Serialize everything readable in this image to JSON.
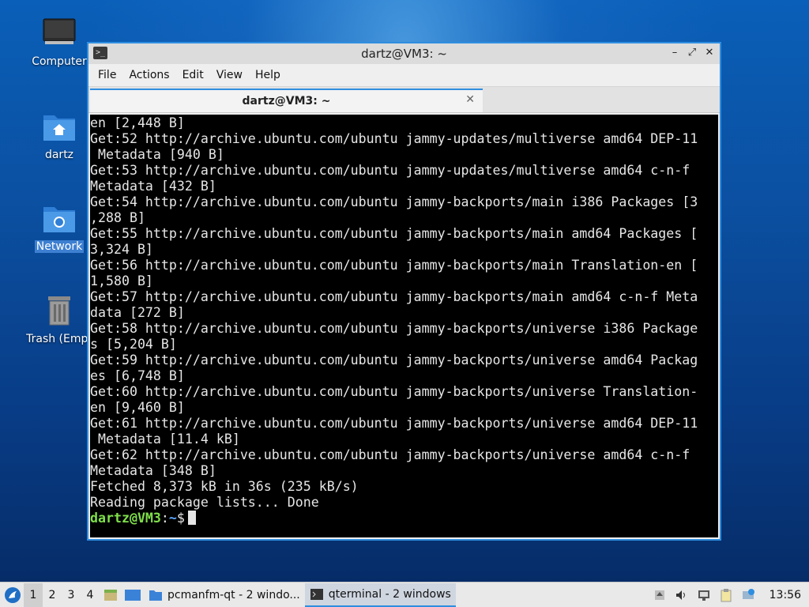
{
  "desktop": {
    "icons": [
      {
        "label": "Computer",
        "icon": "computer-icon"
      },
      {
        "label": "dartz",
        "icon": "home-folder-icon"
      },
      {
        "label": "Network",
        "icon": "network-folder-icon"
      },
      {
        "label": "Trash (Empt",
        "icon": "trash-icon"
      }
    ]
  },
  "window": {
    "title": "dartz@VM3: ~",
    "menu": [
      "File",
      "Actions",
      "Edit",
      "View",
      "Help"
    ],
    "tab_label": "dartz@VM3: ~",
    "tab_close": "✕",
    "terminal_lines": [
      "en [2,448 B]",
      "Get:52 http://archive.ubuntu.com/ubuntu jammy-updates/multiverse amd64 DEP-11",
      " Metadata [940 B]",
      "Get:53 http://archive.ubuntu.com/ubuntu jammy-updates/multiverse amd64 c-n-f",
      "Metadata [432 B]",
      "Get:54 http://archive.ubuntu.com/ubuntu jammy-backports/main i386 Packages [3",
      ",288 B]",
      "Get:55 http://archive.ubuntu.com/ubuntu jammy-backports/main amd64 Packages [",
      "3,324 B]",
      "Get:56 http://archive.ubuntu.com/ubuntu jammy-backports/main Translation-en [",
      "1,580 B]",
      "Get:57 http://archive.ubuntu.com/ubuntu jammy-backports/main amd64 c-n-f Meta",
      "data [272 B]",
      "Get:58 http://archive.ubuntu.com/ubuntu jammy-backports/universe i386 Package",
      "s [5,204 B]",
      "Get:59 http://archive.ubuntu.com/ubuntu jammy-backports/universe amd64 Packag",
      "es [6,748 B]",
      "Get:60 http://archive.ubuntu.com/ubuntu jammy-backports/universe Translation-",
      "en [9,460 B]",
      "Get:61 http://archive.ubuntu.com/ubuntu jammy-backports/universe amd64 DEP-11",
      " Metadata [11.4 kB]",
      "Get:62 http://archive.ubuntu.com/ubuntu jammy-backports/universe amd64 c-n-f",
      "Metadata [348 B]",
      "Fetched 8,373 kB in 36s (235 kB/s)",
      "Reading package lists... Done"
    ],
    "prompt": {
      "user_host": "dartz@VM3",
      "sep": ":",
      "path": "~",
      "symbol": "$"
    }
  },
  "taskbar": {
    "workspaces": [
      "1",
      "2",
      "3",
      "4"
    ],
    "active_workspace": "1",
    "tasks": [
      {
        "label": "pcmanfm-qt - 2 windo...",
        "icon": "folder-icon"
      },
      {
        "label": "qterminal - 2 windows",
        "icon": "terminal-icon"
      }
    ],
    "clock": "13:56"
  }
}
